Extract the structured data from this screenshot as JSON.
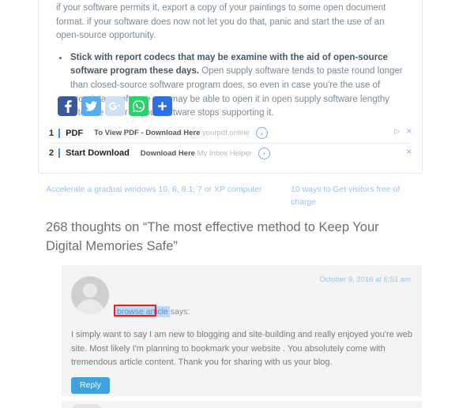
{
  "article": {
    "paragraph_tail": "if your software permits it, export a copy of your paintings to some open document format. if your software does now not let you do that, panic and start the use of an open-source opportunity.",
    "bullets": [
      {
        "lead": "Stick with report codecs that may be examine with the aid of open-source software program these days.",
        "rest": " Open supply software tends to paste round longer than closed-source software program does, so even in case you're the use of proprietary software you may be able to open it in open supply software lengthy after the seller of your software stops supporting it."
      }
    ]
  },
  "social": {
    "buttons": [
      {
        "name": "facebook-share-button",
        "icon": "facebook-icon",
        "color": "#3b5998",
        "glyph": "f"
      },
      {
        "name": "twitter-share-button",
        "icon": "twitter-icon",
        "color": "#55acee",
        "glyph": "t"
      },
      {
        "name": "googleplus-share-button",
        "icon": "google-plus-icon",
        "color": "#cfe0f5",
        "glyph": "G+"
      },
      {
        "name": "whatsapp-share-button",
        "icon": "whatsapp-icon",
        "color": "#25d366",
        "glyph": "w"
      },
      {
        "name": "more-share-button",
        "icon": "plus-icon",
        "color": "#2f6fe4",
        "glyph": "+"
      }
    ]
  },
  "ads": {
    "items": [
      {
        "number": "1",
        "title": "PDF",
        "desc_strong": "To View PDF - Download Here",
        "domain": "yourpdf.online",
        "arrow": "›",
        "close": "×",
        "adchoices": "▷"
      },
      {
        "number": "2",
        "title": "Start Download",
        "desc_strong": "Download Here",
        "domain": "My Inbox Helper",
        "arrow": "›",
        "close": "×",
        "adchoices": ""
      }
    ]
  },
  "related_links": {
    "left": "Accelerate a gradual windows 10, 8, 8.1, 7 or XP computer",
    "right": "10 ways to Get visitors free of charge"
  },
  "comments": {
    "heading": "268 thoughts on “The most effective method to Keep Your Digital Memories Safe”",
    "count": "268",
    "post_title": "The most effective method to Keep Your Digital Memories Safe",
    "items": [
      {
        "date": "October 9, 2016 at 6:51 am",
        "author": "browse article",
        "says_label": "says:",
        "text": "I simply want to say I am new to blogging and site-building and really enjoyed you're web site. Most likely I'm planning to bookmark your website . You absolutely come with tremendous article content. Thank you for sharing with us your blog.",
        "reply_label": "Reply"
      }
    ]
  },
  "colors": {
    "link_blue": "#9dc3e8",
    "reply_button": "#3da2dd",
    "selection_highlight": "#b9d9f5",
    "annotation_box": "#ee1c1c",
    "comment_bg": "#f4f4f4"
  }
}
